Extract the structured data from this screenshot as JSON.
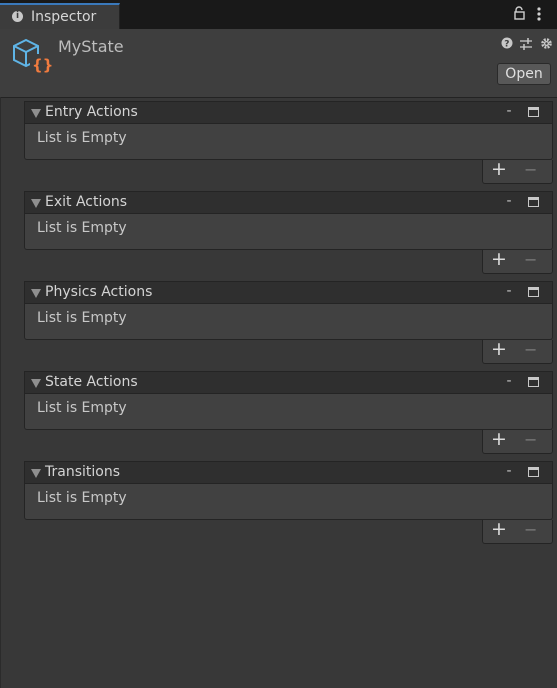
{
  "tab": {
    "label": "Inspector",
    "info_glyph": "i"
  },
  "header": {
    "title": "MyState",
    "open_label": "Open"
  },
  "sections": [
    {
      "title": "Entry Actions",
      "empty_text": "List is Empty",
      "minus": "-",
      "add": "+",
      "remove": "−"
    },
    {
      "title": "Exit Actions",
      "empty_text": "List is Empty",
      "minus": "-",
      "add": "+",
      "remove": "−"
    },
    {
      "title": "Physics Actions",
      "empty_text": "List is Empty",
      "minus": "-",
      "add": "+",
      "remove": "−"
    },
    {
      "title": "State Actions",
      "empty_text": "List is Empty",
      "minus": "-",
      "add": "+",
      "remove": "−"
    },
    {
      "title": "Transitions",
      "empty_text": "List is Empty",
      "minus": "-",
      "add": "+",
      "remove": "−"
    }
  ],
  "icons": [
    "info-icon",
    "lock-icon",
    "menu-icon",
    "scriptable-object-icon",
    "help-icon",
    "preset-icon",
    "gear-icon",
    "foldout-icon",
    "maximize-icon"
  ],
  "colors": {
    "background": "#383838",
    "tab_accent": "#3a79bb",
    "asset_cube": "#5fb4e6",
    "asset_braces": "#f07b3f"
  }
}
